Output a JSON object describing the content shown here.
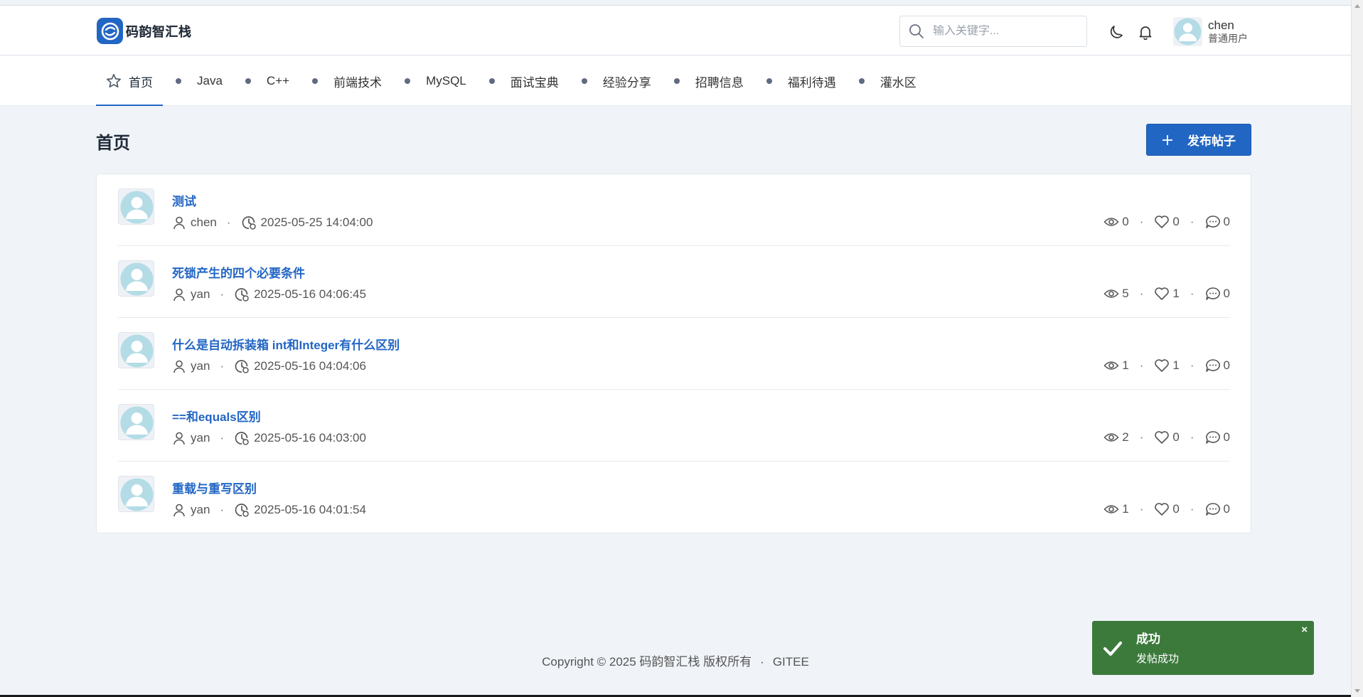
{
  "header": {
    "logo_text": "码韵智汇栈",
    "search": {
      "placeholder": "输入关键字...",
      "value": ""
    },
    "user": {
      "name": "chen",
      "role": "普通用户"
    }
  },
  "nav": {
    "items": [
      {
        "label": "首页",
        "icon": "star-icon",
        "active": true
      },
      {
        "label": "Java"
      },
      {
        "label": "C++"
      },
      {
        "label": "前端技术"
      },
      {
        "label": "MySQL"
      },
      {
        "label": "面试宝典"
      },
      {
        "label": "经验分享"
      },
      {
        "label": "招聘信息"
      },
      {
        "label": "福利待遇"
      },
      {
        "label": "灌水区"
      }
    ]
  },
  "page": {
    "title": "首页",
    "publish_label": "发布帖子"
  },
  "posts": [
    {
      "title": "测试",
      "author": "chen",
      "time": "2025-05-25 14:04:00",
      "views": "0",
      "likes": "0",
      "comments": "0"
    },
    {
      "title": "死锁产生的四个必要条件",
      "author": "yan",
      "time": "2025-05-16 04:06:45",
      "views": "5",
      "likes": "1",
      "comments": "0"
    },
    {
      "title": "什么是自动拆装箱 int和Integer有什么区别",
      "author": "yan",
      "time": "2025-05-16 04:04:06",
      "views": "1",
      "likes": "1",
      "comments": "0"
    },
    {
      "title": "==和equals区别",
      "author": "yan",
      "time": "2025-05-16 04:03:00",
      "views": "2",
      "likes": "0",
      "comments": "0"
    },
    {
      "title": "重载与重写区别",
      "author": "yan",
      "time": "2025-05-16 04:01:54",
      "views": "1",
      "likes": "0",
      "comments": "0"
    }
  ],
  "footer": {
    "copyright": "Copyright © 2025 码韵智汇栈 版权所有",
    "separator": "·",
    "link": "GITEE"
  },
  "toast": {
    "title": "成功",
    "message": "发帖成功",
    "close": "×"
  },
  "colors": {
    "accent": "#2266c4",
    "background": "#f0f4f8",
    "toast_success": "#3c7a3c"
  }
}
